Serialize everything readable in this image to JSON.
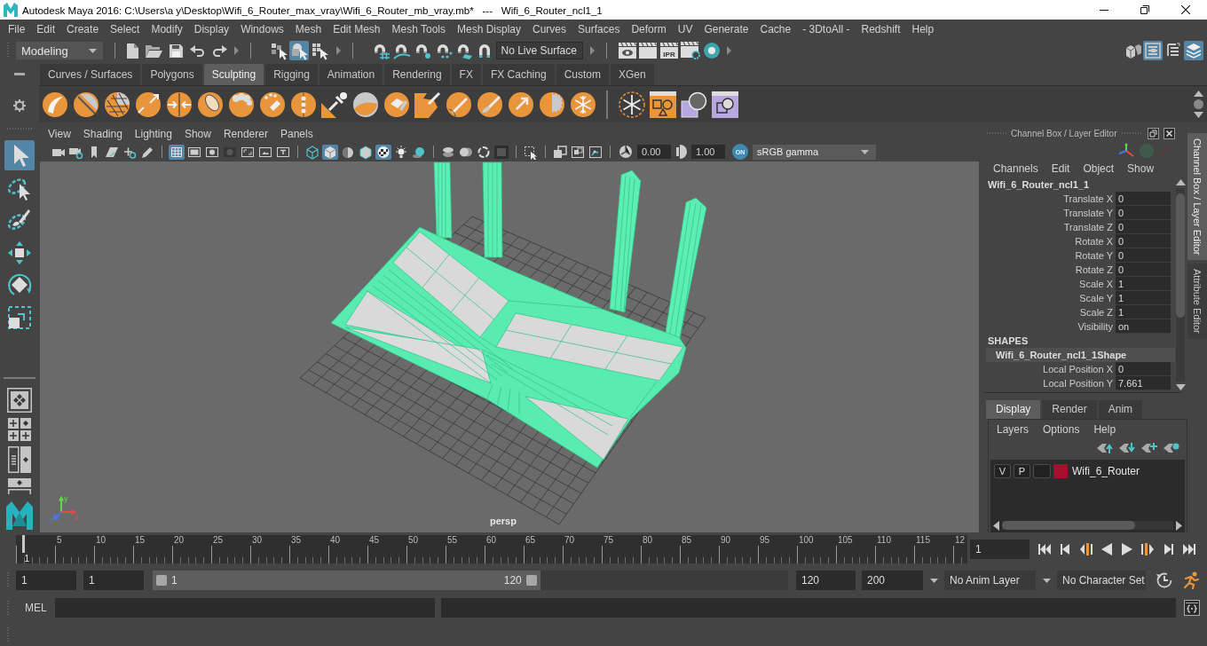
{
  "window": {
    "title": "Autodesk Maya 2016: C:\\Users\\a y\\Desktop\\Wifi_6_Router_max_vray\\Wifi_6_Router_mb_vray.mb*   ---   Wifi_6_Router_ncl1_1"
  },
  "menu_bar": [
    "File",
    "Edit",
    "Create",
    "Select",
    "Modify",
    "Display",
    "Windows",
    "Mesh",
    "Edit Mesh",
    "Mesh Tools",
    "Mesh Display",
    "Curves",
    "Surfaces",
    "Deform",
    "UV",
    "Generate",
    "Cache",
    "- 3DtoAll -",
    "Redshift",
    "Help"
  ],
  "status_line": {
    "menu_set": "Modeling",
    "select_modes": [
      {
        "selected": false
      },
      {
        "selected": true
      },
      {
        "selected": false
      }
    ],
    "live_surface": "No Live Surface",
    "render_label": "IPR",
    "panel_toggles": [
      {
        "on": false
      },
      {
        "on": true
      },
      {
        "on": false
      },
      {
        "on": true
      }
    ]
  },
  "shelf": {
    "tabs": [
      {
        "label": "Curves / Surfaces",
        "selected": false
      },
      {
        "label": "Polygons",
        "selected": false
      },
      {
        "label": "Sculpting",
        "selected": true
      },
      {
        "label": "Rigging",
        "selected": false
      },
      {
        "label": "Animation",
        "selected": false
      },
      {
        "label": "Rendering",
        "selected": false
      },
      {
        "label": "FX",
        "selected": false
      },
      {
        "label": "FX Caching",
        "selected": false
      },
      {
        "label": "Custom",
        "selected": false
      },
      {
        "label": "XGen",
        "selected": false
      }
    ]
  },
  "toolbox": {
    "tools": [
      {
        "selected": true
      },
      {
        "selected": false
      },
      {
        "selected": false
      },
      {
        "selected": false
      },
      {
        "selected": false
      },
      {
        "selected": false
      }
    ]
  },
  "viewport": {
    "menus": [
      "View",
      "Shading",
      "Lighting",
      "Show",
      "Renderer",
      "Panels"
    ],
    "toggles": [
      {
        "on": false
      },
      {
        "on": false
      },
      {
        "on": false
      },
      {
        "on": false
      },
      {
        "on": false
      },
      {
        "on": false
      },
      {
        "on": true
      },
      {
        "on": false
      },
      {
        "on": false
      },
      {
        "on": false
      },
      {
        "on": false
      },
      {
        "on": false
      },
      {
        "on": false
      },
      {
        "on": false
      },
      {
        "on": true
      },
      {
        "on": false
      },
      {
        "on": false
      },
      {
        "on": true
      },
      {
        "on": false
      },
      {
        "on": false
      },
      {
        "on": false
      },
      {
        "on": false
      },
      {
        "on": false
      },
      {
        "on": false
      },
      {
        "on": false
      },
      {
        "on": false
      },
      {
        "on": false
      },
      {
        "on": false
      }
    ],
    "exposure": "0.00",
    "gamma": "1.00",
    "color_management": "ON",
    "color_space": "sRGB gamma",
    "camera": "persp",
    "axes": [
      {
        "label": "y",
        "color": "#5ed84a"
      },
      {
        "label": "z",
        "color": "#4f6ff0"
      },
      {
        "label": "x",
        "color": "#e8484a"
      }
    ]
  },
  "channel_box": {
    "title": "Channel Box / Layer Editor",
    "menus": [
      "Channels",
      "Edit",
      "Object",
      "Show"
    ],
    "object": "Wifi_6_Router_ncl1_1",
    "attributes": [
      {
        "name": "Translate X",
        "value": "0"
      },
      {
        "name": "Translate Y",
        "value": "0"
      },
      {
        "name": "Translate Z",
        "value": "0"
      },
      {
        "name": "Rotate X",
        "value": "0"
      },
      {
        "name": "Rotate Y",
        "value": "0"
      },
      {
        "name": "Rotate Z",
        "value": "0"
      },
      {
        "name": "Scale X",
        "value": "1"
      },
      {
        "name": "Scale Y",
        "value": "1"
      },
      {
        "name": "Scale Z",
        "value": "1"
      },
      {
        "name": "Visibility",
        "value": "on"
      }
    ],
    "shapes_heading": "SHAPES",
    "shape": "Wifi_6_Router_ncl1_1Shape",
    "shape_attributes": [
      {
        "name": "Local Position X",
        "value": "0"
      },
      {
        "name": "Local Position Y",
        "value": "7.661"
      }
    ]
  },
  "layer_editor": {
    "tabs": [
      {
        "label": "Display",
        "selected": true
      },
      {
        "label": "Render",
        "selected": false
      },
      {
        "label": "Anim",
        "selected": false
      }
    ],
    "menus": [
      "Layers",
      "Options",
      "Help"
    ],
    "layers": [
      {
        "visibility": "V",
        "playback": "P",
        "name": "Wifi_6_Router",
        "color": "#a3102e"
      }
    ]
  },
  "side_tabs": [
    {
      "label": "Channel Box / Layer Editor",
      "selected": true
    },
    {
      "label": "Attribute Editor",
      "selected": false
    }
  ],
  "time_slider": {
    "frame_labels": [
      "5",
      "10",
      "15",
      "20",
      "25",
      "30",
      "35",
      "40",
      "45",
      "50",
      "55",
      "60",
      "65",
      "70",
      "75",
      "80",
      "85",
      "90",
      "95",
      "100",
      "105",
      "110",
      "115",
      "12"
    ],
    "level": 0.008,
    "current_frame": "1",
    "current_frame_field": "1"
  },
  "range_slider": {
    "start_time": "1",
    "playback_start": "1",
    "range_start": "1",
    "range_end": "120",
    "level": 0.61,
    "playback_end": "120",
    "end_time": "200",
    "anim_layer": "No Anim Layer",
    "character_set": "No Character Set"
  },
  "command_line": {
    "language": "MEL"
  }
}
